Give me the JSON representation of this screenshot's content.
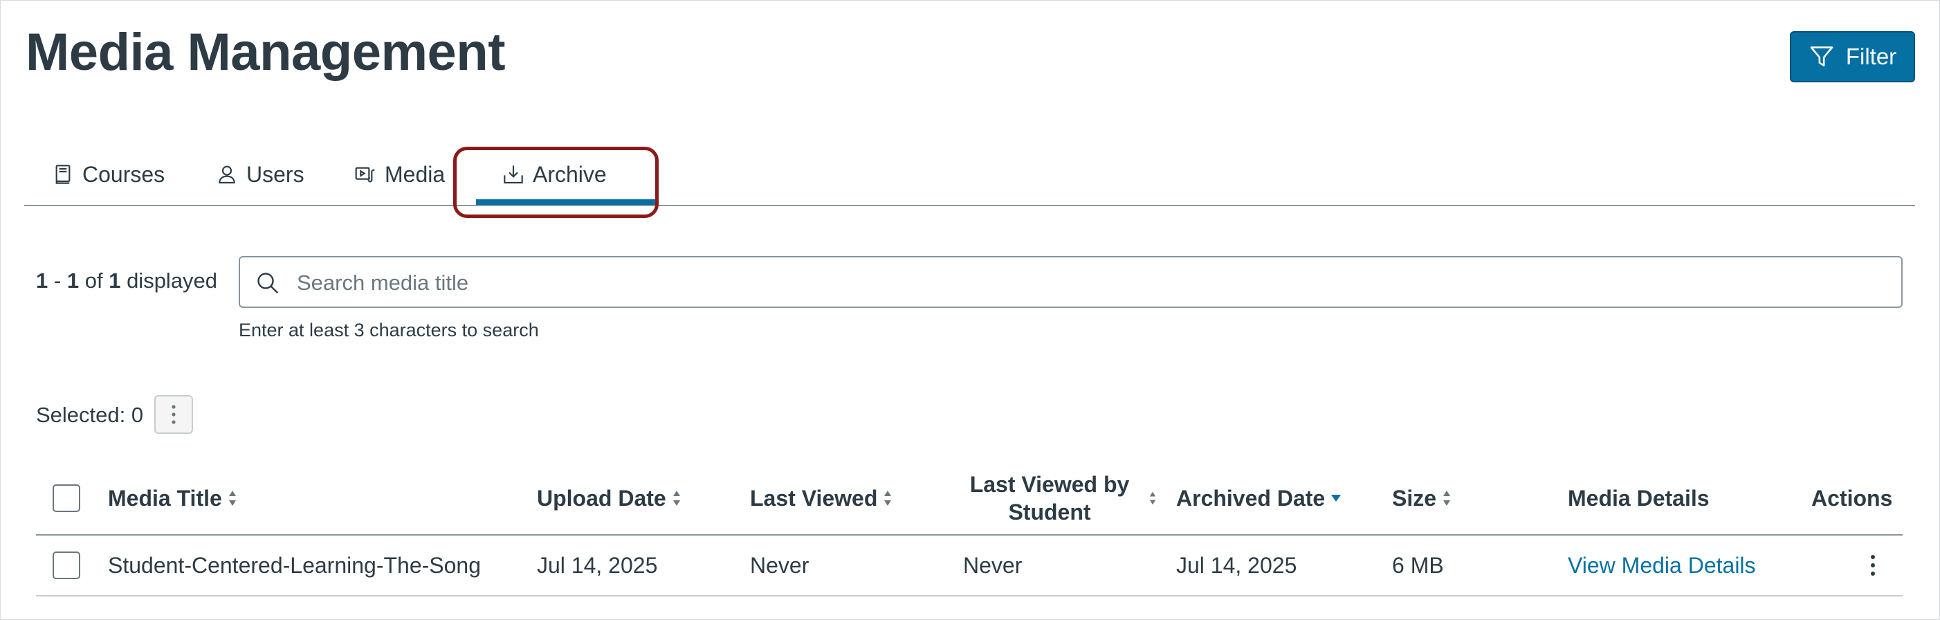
{
  "page": {
    "title": "Media Management",
    "filter_label": "Filter"
  },
  "tabs": [
    {
      "label": "Courses",
      "icon": "book-icon"
    },
    {
      "label": "Users",
      "icon": "user-icon"
    },
    {
      "label": "Media",
      "icon": "media-icon"
    },
    {
      "label": "Archive",
      "icon": "archive-download-icon",
      "selected": true
    }
  ],
  "summary": {
    "range_start": "1",
    "range_sep": "-",
    "range_end": "1",
    "of_word": "of",
    "total": "1",
    "displayed_word": "displayed"
  },
  "search": {
    "placeholder": "Search media title",
    "value": "",
    "hint": "Enter at least 3 characters to search"
  },
  "selection": {
    "label": "Selected: 0"
  },
  "table": {
    "columns": [
      {
        "label": "Media Title",
        "sort": "unsorted"
      },
      {
        "label": "Upload Date",
        "sort": "unsorted"
      },
      {
        "label": "Last Viewed",
        "sort": "unsorted"
      },
      {
        "label": "Last Viewed by Student",
        "sort": "unsorted"
      },
      {
        "label": "Archived Date",
        "sort": "descending"
      },
      {
        "label": "Size",
        "sort": "unsorted"
      },
      {
        "label": "Media Details"
      },
      {
        "label": "Actions"
      }
    ],
    "rows": [
      {
        "media_title": "Student-Centered-Learning-The-Song",
        "upload_date": "Jul 14, 2025",
        "last_viewed": "Never",
        "last_viewed_by_student": "Never",
        "archived_date": "Jul 14, 2025",
        "size": "6 MB",
        "media_details_link": "View Media Details"
      }
    ]
  },
  "colors": {
    "primary": "#0770a3",
    "text": "#2d3b45",
    "highlight": "#8b1a1a"
  }
}
